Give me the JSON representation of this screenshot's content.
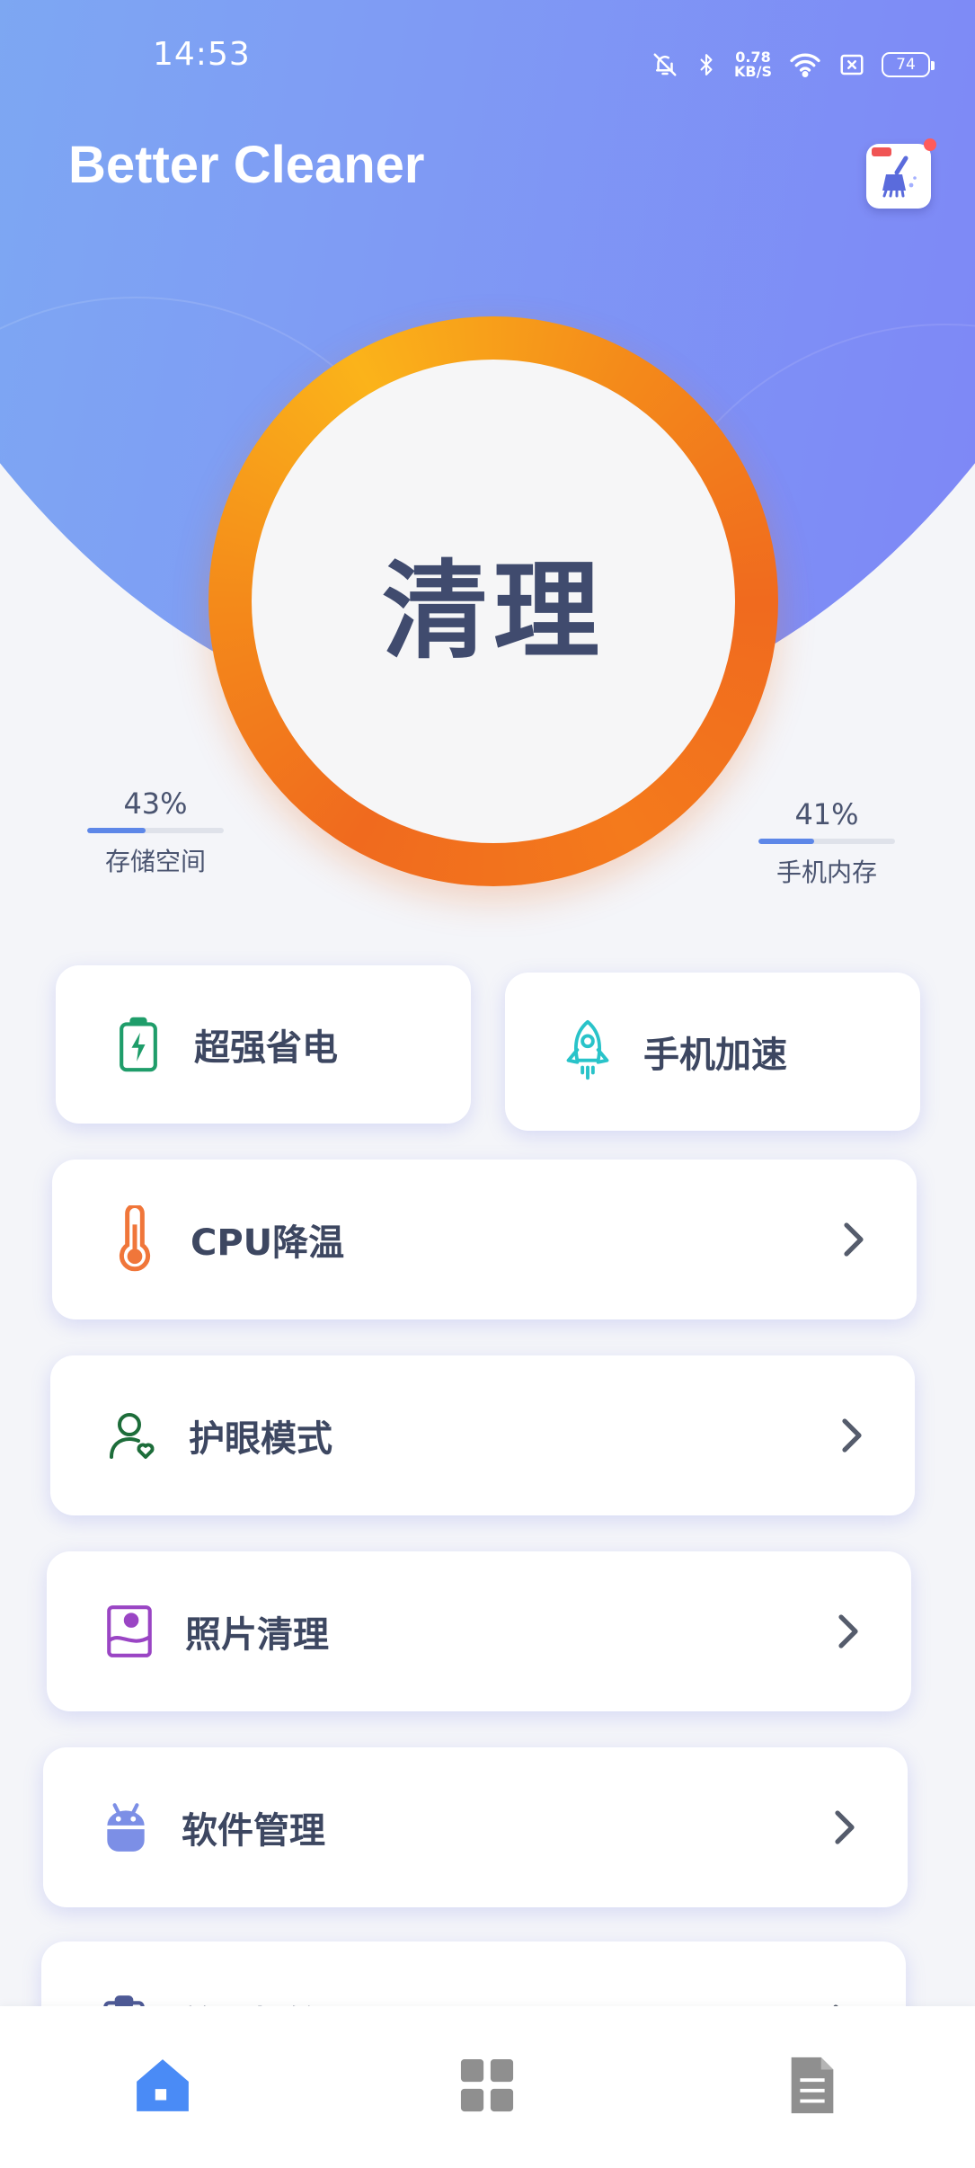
{
  "status_bar": {
    "time": "14:53",
    "net_speed_value": "0.78",
    "net_speed_unit": "KB/S",
    "battery": "74",
    "icons": [
      "mute-bell-icon",
      "bluetooth-icon",
      "wifi-icon",
      "sim-x-icon",
      "battery-icon"
    ]
  },
  "header": {
    "title": "Better Cleaner",
    "app_icon": "broom-cleaner-icon"
  },
  "clean_button": {
    "label": "清理"
  },
  "stats": {
    "storage": {
      "percent_label": "43%",
      "percent": 43,
      "name": "存储空间"
    },
    "memory": {
      "percent_label": "41%",
      "percent": 41,
      "name": "手机内存"
    }
  },
  "features": {
    "power_saving": {
      "label": "超强省电",
      "icon": "battery-charging-icon"
    },
    "phone_boost": {
      "label": "手机加速",
      "icon": "rocket-icon"
    },
    "cpu_cooling": {
      "label": "CPU降温",
      "icon": "thermometer-icon"
    },
    "eye_care": {
      "label": "护眼模式",
      "icon": "user-heart-icon"
    },
    "photo_clean": {
      "label": "照片清理",
      "icon": "photo-icon"
    },
    "app_manager": {
      "label": "软件管理",
      "icon": "android-icon"
    },
    "clipboard_manager": {
      "label": "剪切板管理",
      "icon": "clipboard-icon"
    }
  },
  "bottom_nav": {
    "items": [
      {
        "icon": "home-icon",
        "active": true
      },
      {
        "icon": "grid-icon",
        "active": false
      },
      {
        "icon": "document-icon",
        "active": false
      }
    ]
  },
  "colors": {
    "accent_orange": "#f48a1a",
    "header_gradient_start": "#79b6f0",
    "header_gradient_end": "#7e7ff7",
    "nav_active": "#4a8bf6",
    "nav_inactive": "#8f8f8f"
  }
}
